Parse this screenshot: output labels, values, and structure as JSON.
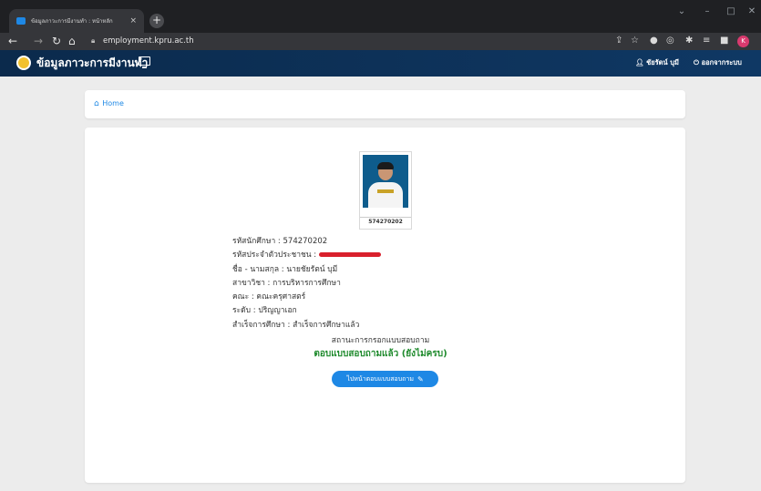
{
  "browser": {
    "tab_title": "ข้อมูลภาวะการมีงานทำ : หน้าหลัก",
    "tab_close": "×",
    "new_tab": "+",
    "url": "employment.kpru.ac.th",
    "profile_initial": "K",
    "window_controls": [
      "⌄",
      "–",
      "□",
      "✕"
    ]
  },
  "header": {
    "title": "ข้อมูลภาวะการมีงานทำ",
    "user_name": "ชัยรัตน์ บุมี",
    "logout_label": "ออกจากระบบ"
  },
  "breadcrumb": {
    "home_label": "Home"
  },
  "profile": {
    "photo_caption": "574270202",
    "student_id_label": "รหัสนักศึกษา : 574270202",
    "citizen_id_label": "รหัสประจำตัวประชาชน :",
    "name_label": "ชื่อ - นามสกุล : นายชัยรัตน์ บุมี",
    "major_label": "สาขาวิชา : การบริหารการศึกษา",
    "faculty_label": "คณะ : คณะครุศาสตร์",
    "level_label": "ระดับ : ปริญญาเอก",
    "graduation_label": "สำเร็จการศึกษา : สำเร็จการศึกษาแล้ว"
  },
  "survey": {
    "status_heading": "สถานะการกรอกแบบสอบถาม",
    "status_value": "ตอบแบบสอบถามแล้ว (ยังไม่ครบ)",
    "button_label": "ไปหน้าตอบแบบสอบถาม"
  },
  "colors": {
    "header_bg": "#0f3864",
    "link": "#1e88e5",
    "status": "#1e8a2c",
    "redaction": "#d9202c"
  }
}
